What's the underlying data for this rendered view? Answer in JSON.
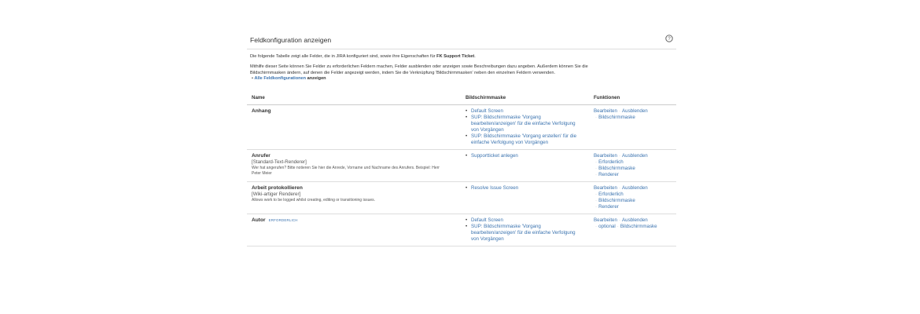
{
  "page": {
    "title": "Feldkonfiguration anzeigen",
    "intro_text": "Die folgende Tabelle zeigt alle Felder, die in JIRA konfiguriert sind, sowie ihre Eigenschaften für",
    "intro_bold": "FK Support Ticket",
    "intro_end": ".",
    "help_line1": "Mithilfe dieser Seite können Sie Felder zu erforderlichen Feldern machen, Felder ausblenden oder anzeigen sowie Beschreibungen dazu angeben. Außerdem können Sie die",
    "help_line2": "Bildschirmmasken ändern, auf denen die Felder angezeigt werden, indem Sie die Verknüpfung 'Bildschirmmasken' neben den einzelnen Feldern verwenden.",
    "all_link": "Alle Feldkonfigurationen",
    "all_suffix": "anzeigen"
  },
  "table": {
    "headers": [
      "Name",
      "Bildschirmmaske",
      "Funktionen"
    ],
    "rows": [
      {
        "name": "Anhang",
        "renderer": "",
        "description": "",
        "badge": "",
        "screens": [
          "Default Screen",
          "SUP: Bildschirmmaske 'Vorgang bearbeiten/anzeigen' für die einfache Verfolgung von Vorgängen",
          "SUP: Bildschirmmaske 'Vorgang erstellen' für die einfache Verfolgung von Vorgängen"
        ],
        "ops": [
          "Bearbeiten",
          "Ausblenden",
          "Bildschirmmaske"
        ]
      },
      {
        "name": "Anrufer",
        "renderer": "[Standard-Text-Renderer]",
        "description": "Wer hat angerufen? Bitte notieren Sie hier die Anrede, Vorname und Nachname des Anrufers. Beispiel: Herr Peter Meier",
        "badge": "",
        "screens": [
          "Supportticket anlegen"
        ],
        "ops": [
          "Bearbeiten",
          "Ausblenden",
          "Erforderlich",
          "Bildschirmmaske",
          "Renderer"
        ]
      },
      {
        "name": "Arbeit protokollieren",
        "renderer": "[Wiki-artiger Renderer]",
        "description": "Allows work to be logged whilst creating, editing or transitioning issues.",
        "badge": "",
        "screens": [
          "Resolve Issue Screen"
        ],
        "ops": [
          "Bearbeiten",
          "Ausblenden",
          "Erforderlich",
          "Bildschirmmaske",
          "Renderer"
        ]
      },
      {
        "name": "Autor",
        "renderer": "",
        "description": "",
        "badge": "ERFORDERLICH",
        "screens": [
          "Default Screen",
          "SUP: Bildschirmmaske 'Vorgang bearbeiten/anzeigen' für die einfache Verfolgung von Vorgängen"
        ],
        "ops": [
          "Bearbeiten",
          "Ausblenden",
          "optional",
          "Bildschirmmaske"
        ]
      }
    ]
  }
}
